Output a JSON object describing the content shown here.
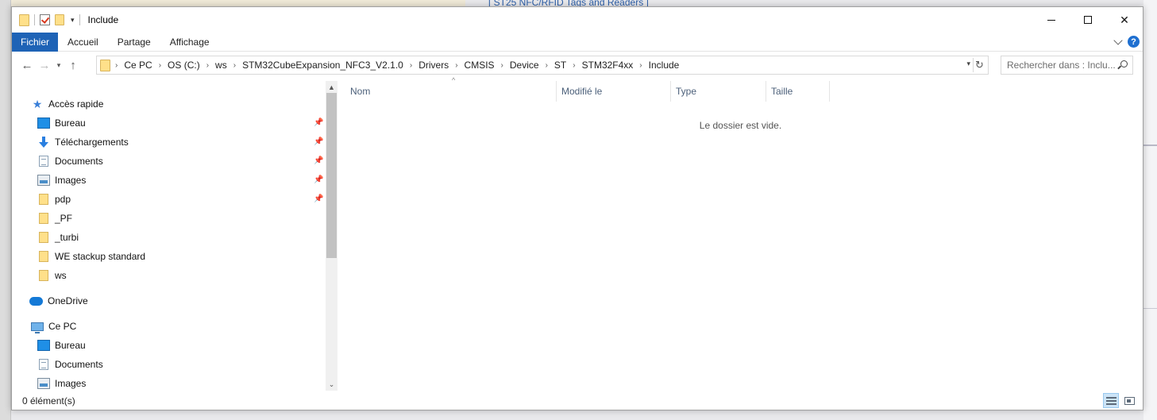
{
  "background": {
    "link_text": "[  ST25 NFC/RFID Tags and Readers  ]"
  },
  "window": {
    "title": "Include",
    "controls": {
      "minimize": "",
      "maximize": "",
      "close": "✕"
    }
  },
  "ribbon": {
    "tabs": [
      "Fichier",
      "Accueil",
      "Partage",
      "Affichage"
    ],
    "help": "?"
  },
  "address": {
    "crumbs": [
      "Ce PC",
      "OS (C:)",
      "ws",
      "STM32CubeExpansion_NFC3_V2.1.0",
      "Drivers",
      "CMSIS",
      "Device",
      "ST",
      "STM32F4xx",
      "Include"
    ],
    "search_placeholder": "Rechercher dans : Inclu..."
  },
  "navpane": {
    "items": [
      {
        "label": "Accès rapide",
        "icon": "star-icon",
        "pinned": false
      },
      {
        "label": "Bureau",
        "icon": "desktop-icon",
        "pinned": true
      },
      {
        "label": "Téléchargements",
        "icon": "download-icon",
        "pinned": true
      },
      {
        "label": "Documents",
        "icon": "document-icon",
        "pinned": true
      },
      {
        "label": "Images",
        "icon": "images-icon",
        "pinned": true
      },
      {
        "label": "pdp",
        "icon": "folder-icon",
        "pinned": true
      },
      {
        "label": "_PF",
        "icon": "folder-icon",
        "pinned": false
      },
      {
        "label": "_turbi",
        "icon": "folder-icon",
        "pinned": false
      },
      {
        "label": "WE stackup standard",
        "icon": "folder-icon",
        "pinned": false
      },
      {
        "label": "ws",
        "icon": "folder-icon",
        "pinned": false
      },
      {
        "label": "OneDrive",
        "icon": "cloud-icon",
        "pinned": false
      },
      {
        "label": "Ce PC",
        "icon": "pc-icon",
        "pinned": false
      },
      {
        "label": "Bureau",
        "icon": "desktop-icon",
        "pinned": false
      },
      {
        "label": "Documents",
        "icon": "document-icon",
        "pinned": false
      },
      {
        "label": "Images",
        "icon": "images-icon",
        "pinned": false
      }
    ]
  },
  "content": {
    "columns": [
      "Nom",
      "Modifié le",
      "Type",
      "Taille"
    ],
    "empty_message": "Le dossier est vide."
  },
  "status": {
    "item_count": "0 élément(s)"
  },
  "colors": {
    "accent": "#1e63b6",
    "header_text": "#4c607a"
  }
}
